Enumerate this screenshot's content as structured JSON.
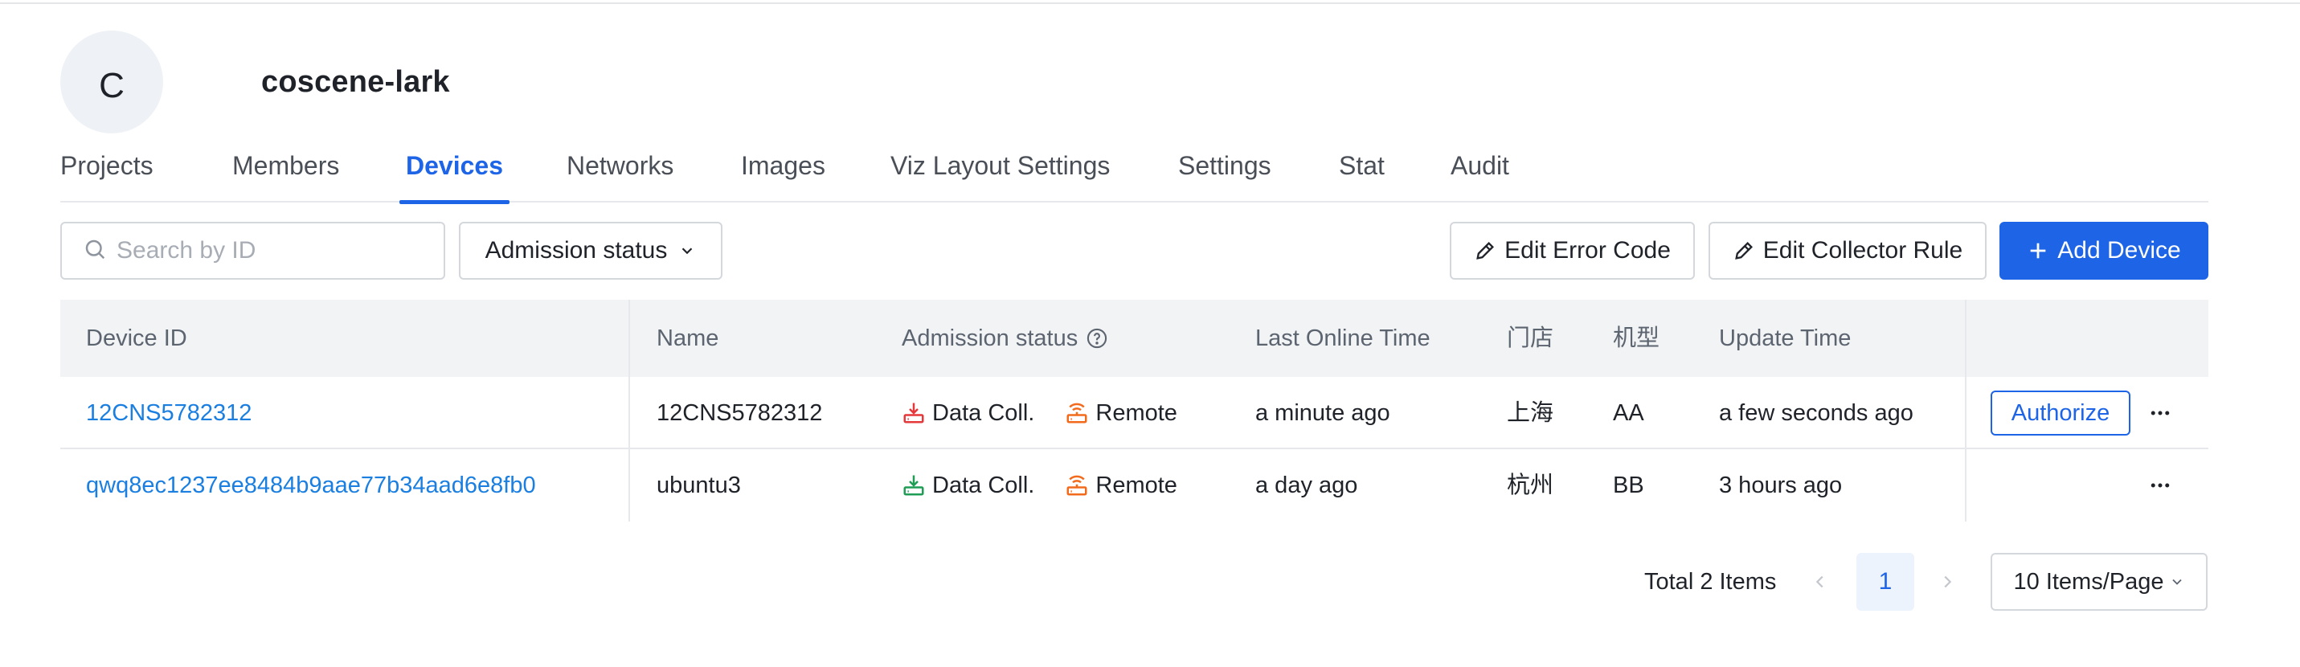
{
  "org": {
    "avatar_letter": "C",
    "name": "coscene-lark"
  },
  "tabs": [
    {
      "label": "Projects",
      "active": false
    },
    {
      "label": "Members",
      "active": false
    },
    {
      "label": "Devices",
      "active": true
    },
    {
      "label": "Networks",
      "active": false
    },
    {
      "label": "Images",
      "active": false
    },
    {
      "label": "Viz Layout Settings",
      "active": false
    },
    {
      "label": "Settings",
      "active": false
    },
    {
      "label": "Stat",
      "active": false
    },
    {
      "label": "Audit",
      "active": false
    }
  ],
  "toolbar": {
    "search_placeholder": "Search by ID",
    "search_icon": "search-icon",
    "admission_filter_label": "Admission status",
    "edit_error_code_label": "Edit Error Code",
    "edit_collector_rule_label": "Edit Collector Rule",
    "add_device_label": "Add Device"
  },
  "table": {
    "headers": {
      "device_id": "Device ID",
      "name": "Name",
      "admission_status": "Admission status",
      "last_online_time": "Last Online Time",
      "store": "门店",
      "model": "机型",
      "update_time": "Update Time"
    },
    "rows": [
      {
        "device_id": "12CNS5782312",
        "name": "12CNS5782312",
        "data_coll_label": "Data Coll.",
        "data_coll_color": "#e5383b",
        "remote_label": "Remote",
        "remote_color": "#f26a1b",
        "last_online_time": "a minute ago",
        "store": "上海",
        "model": "AA",
        "update_time": "a few seconds ago",
        "action_label": "Authorize"
      },
      {
        "device_id": "qwq8ec1237ee8484b9aae77b34aad6e8fb0",
        "name": "ubuntu3",
        "data_coll_label": "Data Coll.",
        "data_coll_color": "#1f9d55",
        "remote_label": "Remote",
        "remote_color": "#f26a1b",
        "last_online_time": "a day ago",
        "store": "杭州",
        "model": "BB",
        "update_time": "3 hours ago",
        "action_label": ""
      }
    ]
  },
  "pagination": {
    "total_label": "Total 2 Items",
    "current_page": "1",
    "page_size_label": "10 Items/Page"
  },
  "colors": {
    "accent": "#1d64e6",
    "link": "#1a7fe0",
    "header_bg": "#f2f3f5"
  }
}
